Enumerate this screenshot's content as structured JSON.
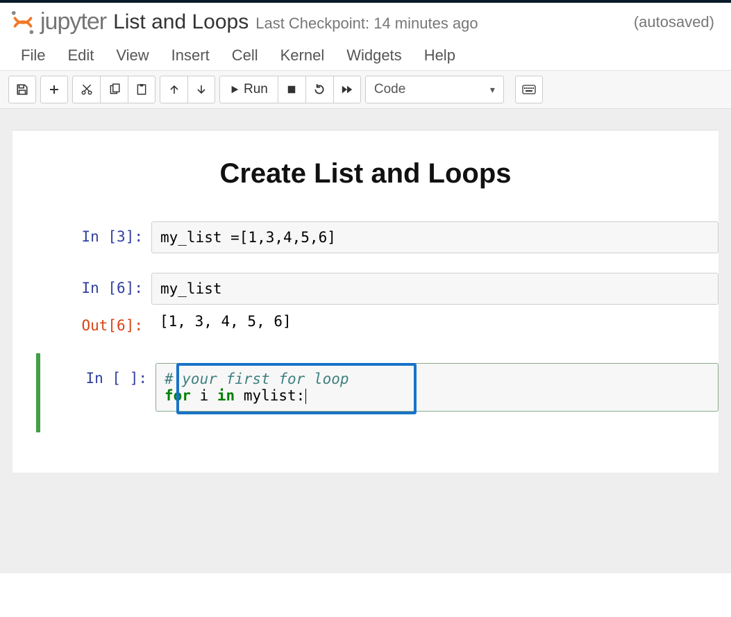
{
  "brand": "jupyter",
  "notebook_title": "List and Loops",
  "checkpoint_text": "Last Checkpoint: 14 minutes ago",
  "autosave_text": "(autosaved)",
  "menu": {
    "file": "File",
    "edit": "Edit",
    "view": "View",
    "insert": "Insert",
    "cell": "Cell",
    "kernel": "Kernel",
    "widgets": "Widgets",
    "help": "Help"
  },
  "toolbar": {
    "run_label": "Run",
    "cell_type": "Code"
  },
  "heading": "Create List and Loops",
  "cells": [
    {
      "type": "code",
      "in_prompt": "In [3]:",
      "source": "my_list =[1,3,4,5,6]"
    },
    {
      "type": "code",
      "in_prompt": "In [6]:",
      "source": "my_list",
      "out_prompt": "Out[6]:",
      "output": "[1, 3, 4, 5, 6]"
    },
    {
      "type": "code",
      "in_prompt": "In [ ]:",
      "active": true,
      "source_comment": "# your first for loop",
      "source_line2_kw1": "for",
      "source_line2_var": " i ",
      "source_line2_kw2": "in",
      "source_line2_rest": " mylist:"
    }
  ]
}
